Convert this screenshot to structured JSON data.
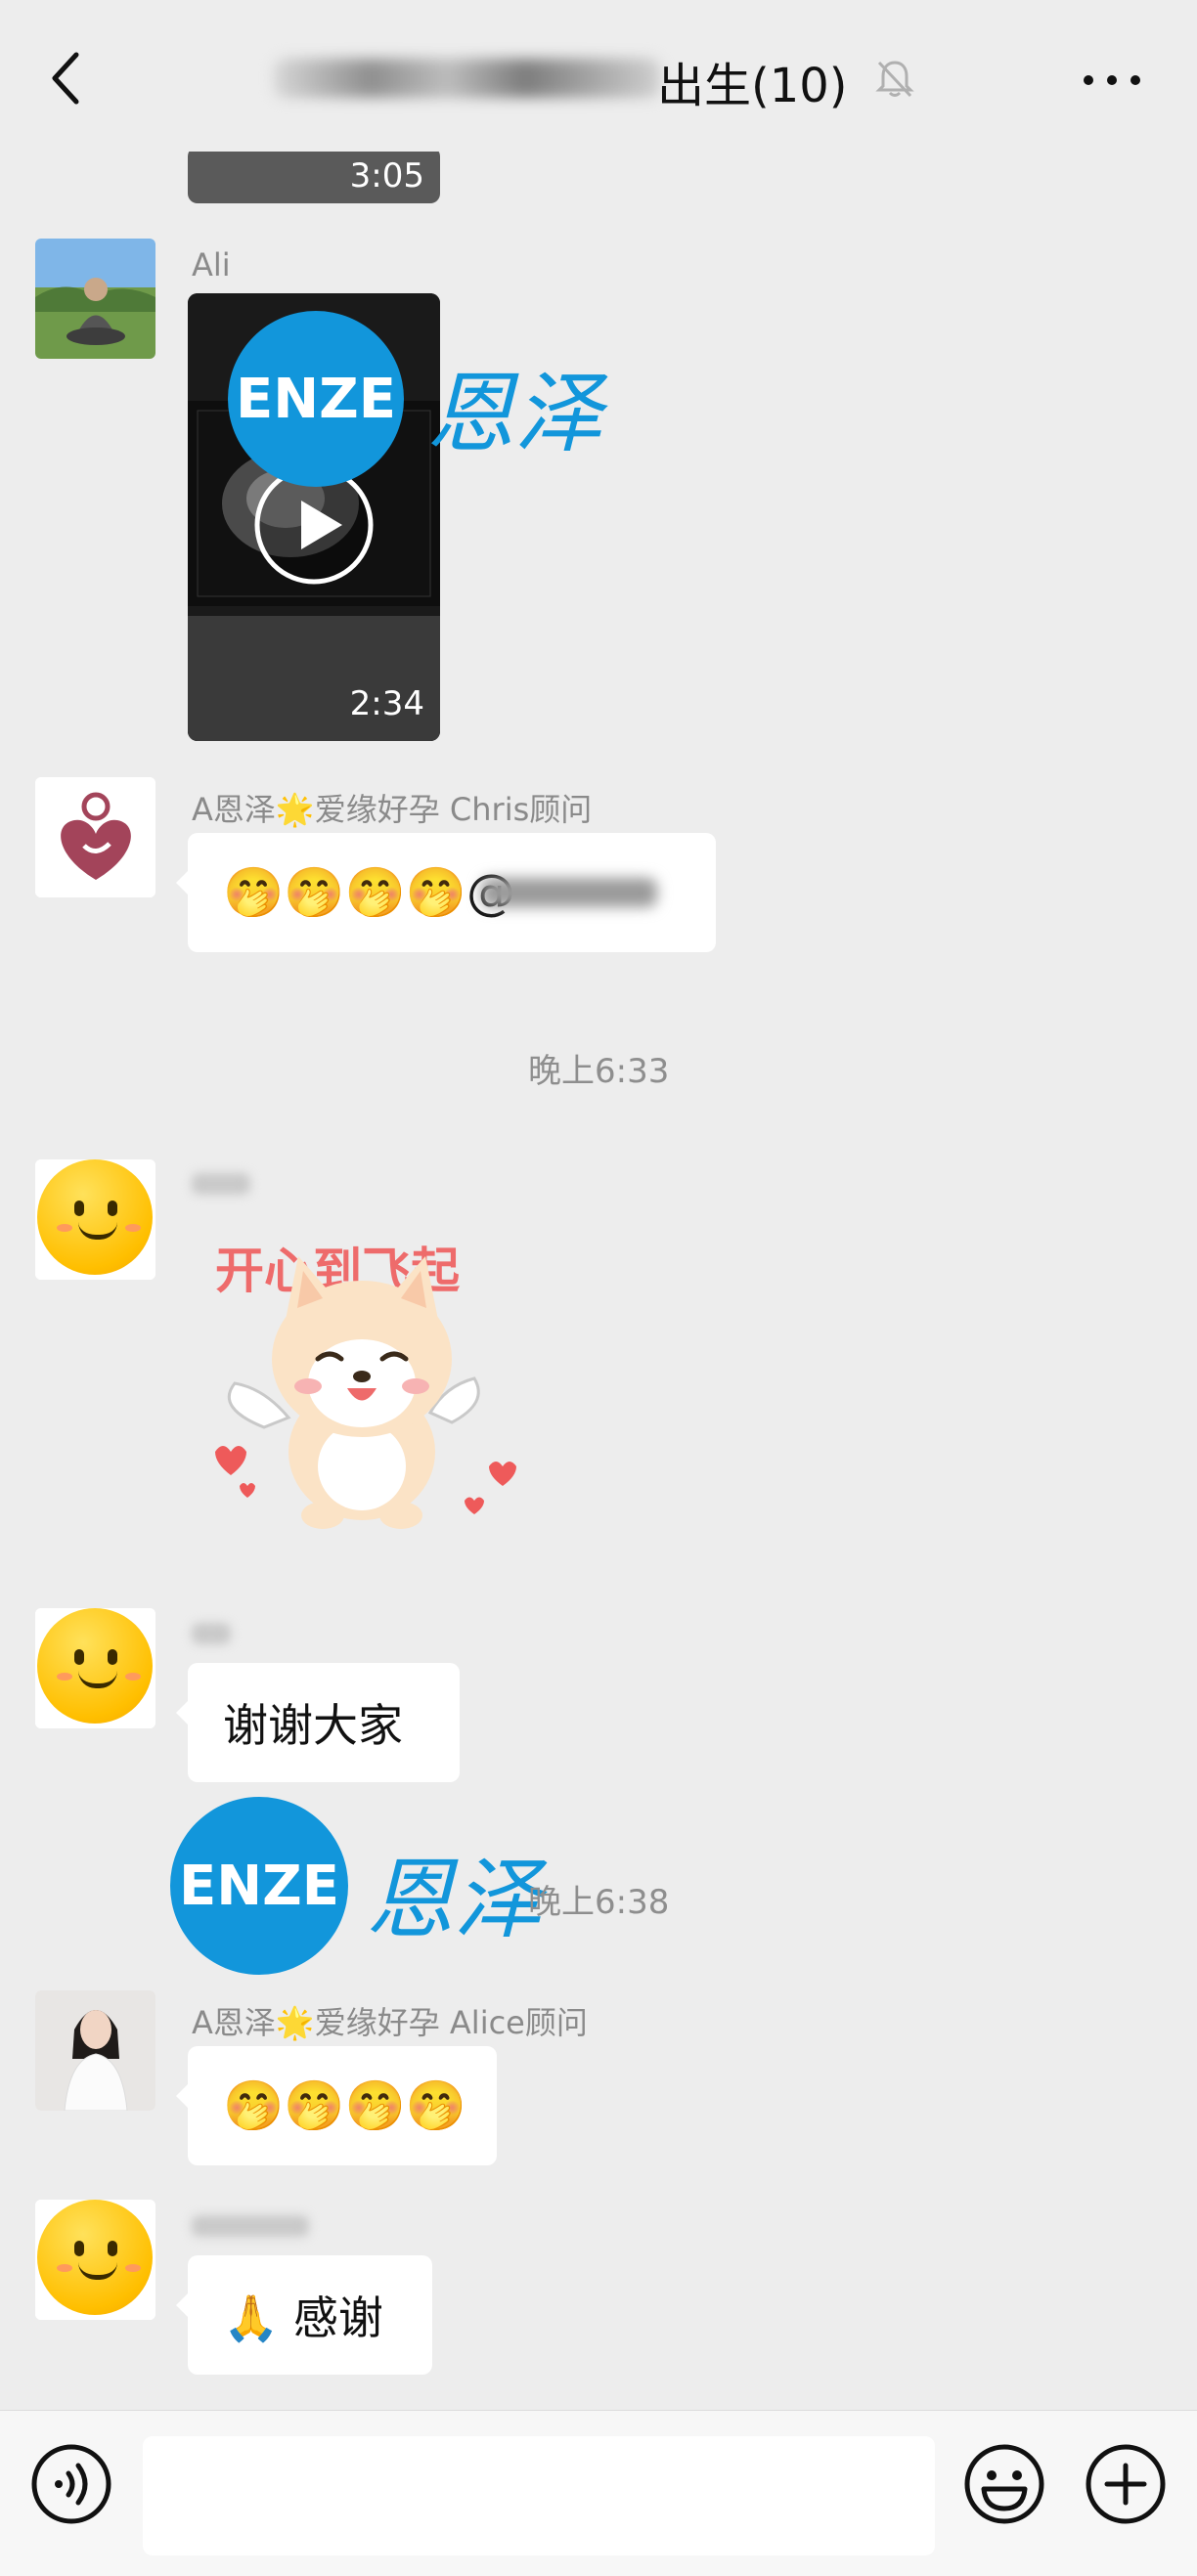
{
  "header": {
    "title": "出生(10)",
    "back_icon": "chevron-left-icon",
    "mute_icon": "bell-off-icon",
    "more_icon": "more-dots-icon"
  },
  "messages": [
    {
      "type": "video",
      "duration": "3:05"
    },
    {
      "type": "video",
      "sender": "Ali",
      "duration": "2:34"
    },
    {
      "type": "text",
      "sender": "A恩泽🌟爱缘好孕 Chris顾问",
      "content": "🤭🤭🤭🤭@"
    },
    {
      "type": "time",
      "text": "晚上6:33"
    },
    {
      "type": "sticker",
      "sticker_text": "开心到飞起"
    },
    {
      "type": "text",
      "content": "谢谢大家"
    },
    {
      "type": "time",
      "text": "晚上6:38"
    },
    {
      "type": "text",
      "sender": "A恩泽🌟爱缘好孕 Alice顾问",
      "content": "🤭🤭🤭🤭"
    },
    {
      "type": "text",
      "content": "🙏 感谢"
    }
  ],
  "watermark": {
    "logo": "ENZE",
    "text": "恩泽"
  },
  "bottom_bar": {
    "voice_icon": "voice-icon",
    "emoji_icon": "emoji-icon",
    "plus_icon": "plus-icon"
  }
}
